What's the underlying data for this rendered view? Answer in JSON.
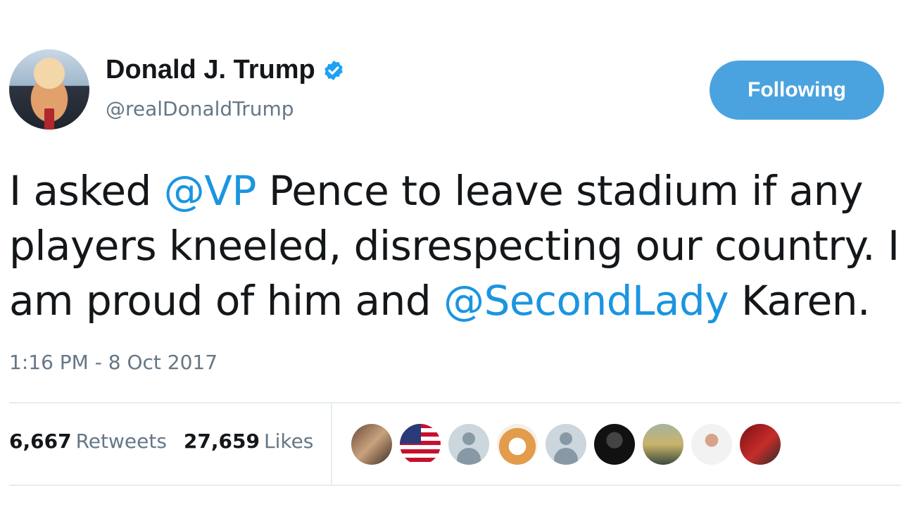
{
  "author": {
    "name": "Donald J. Trump",
    "handle": "@realDonaldTrump",
    "verified": true
  },
  "follow_button": {
    "label": "Following",
    "color": "#4aa3df"
  },
  "tweet": {
    "segments": [
      {
        "text": "I asked ",
        "mention": false
      },
      {
        "text": "@VP",
        "mention": true
      },
      {
        "text": " Pence to leave stadium if any players kneeled, disrespecting our country. I am proud of him and ",
        "mention": false
      },
      {
        "text": "@SecondLady",
        "mention": true
      },
      {
        "text": " Karen.",
        "mention": false
      }
    ],
    "timestamp": "1:16 PM - 8 Oct 2017"
  },
  "stats": {
    "retweets_count": "6,667",
    "retweets_label": "Retweets",
    "likes_count": "27,659",
    "likes_label": "Likes"
  },
  "likers": [
    {
      "icon": "photo-avatar-icon"
    },
    {
      "icon": "flag-avatar-icon"
    },
    {
      "icon": "default-avatar-icon"
    },
    {
      "icon": "dog-avatar-icon"
    },
    {
      "icon": "default-avatar-icon"
    },
    {
      "icon": "dark-avatar-icon"
    },
    {
      "icon": "group-avatar-icon"
    },
    {
      "icon": "figure-avatar-icon"
    },
    {
      "icon": "red-avatar-icon"
    }
  ],
  "colors": {
    "mention": "#1b95e0",
    "secondary_text": "#657786",
    "verified_badge": "#1da1f2"
  }
}
